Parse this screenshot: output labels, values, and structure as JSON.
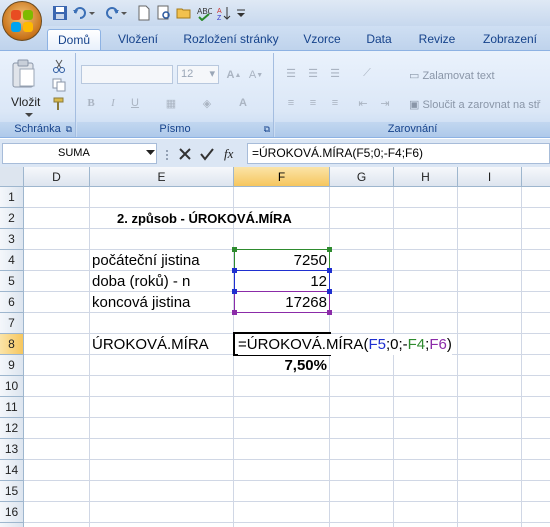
{
  "qat": {
    "icons": [
      "save-icon",
      "undo-icon",
      "redo-icon",
      "new-icon",
      "print-preview-icon",
      "open-icon",
      "spelling-icon",
      "sort-icon",
      "customize-icon"
    ]
  },
  "tabs": [
    {
      "label": "Domů"
    },
    {
      "label": "Vložení"
    },
    {
      "label": "Rozložení stránky"
    },
    {
      "label": "Vzorce"
    },
    {
      "label": "Data"
    },
    {
      "label": "Revize"
    },
    {
      "label": "Zobrazení"
    }
  ],
  "ribbon": {
    "clipboard": {
      "paste_label": "Vložit",
      "group_label": "Schránka"
    },
    "font": {
      "name_value": "",
      "size_value": "12",
      "group_label": "Písmo"
    },
    "alignment": {
      "wrap_label": "Zalamovat text",
      "merge_label": "Sloučit a zarovnat na stř",
      "group_label": "Zarovnání"
    }
  },
  "formula_bar": {
    "name_box": "SUMA",
    "fx_label": "fx",
    "formula": "=ÚROKOVÁ.MÍRA(F5;0;-F4;F6)"
  },
  "sheet": {
    "columns": [
      "D",
      "E",
      "F",
      "G",
      "H",
      "I"
    ],
    "rows": [
      "1",
      "2",
      "3",
      "4",
      "5",
      "6",
      "7",
      "8",
      "9",
      "10",
      "11",
      "12",
      "13",
      "14",
      "15",
      "16",
      "17"
    ],
    "title": "2. způsob - ÚROKOVÁ.MÍRA",
    "labels": {
      "r4": "počáteční jistina",
      "r5": "doba (roků) - n",
      "r6": "koncová jistina",
      "r8": "ÚROKOVÁ.MÍRA"
    },
    "values": {
      "f4": "7250",
      "f5": "12",
      "f6": "17268",
      "f9": "7,50%"
    },
    "edit_formula": {
      "prefix": "=ÚROKOVÁ.MÍRA(",
      "ref1": "F5",
      "sep1": ";0;-",
      "ref2": "F4",
      "sep2": ";",
      "ref3": "F6",
      "suffix": ")"
    }
  },
  "colors": {
    "ref_blue": "#1f2fd0",
    "ref_green": "#2e8b2e",
    "ref_purple": "#8b2ba8",
    "selected_header": "#f6c65e"
  }
}
